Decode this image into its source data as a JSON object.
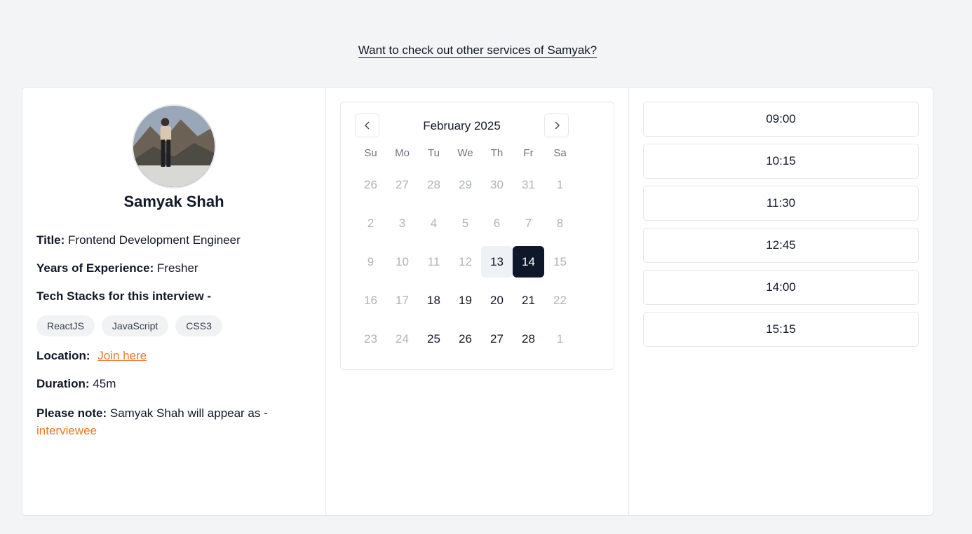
{
  "header": {
    "services_link": "Want to check out other services of Samyak?"
  },
  "profile": {
    "name": "Samyak Shah",
    "title_label": "Title:",
    "title_value": "Frontend Development Engineer",
    "experience_label": "Years of Experience:",
    "experience_value": "Fresher",
    "tech_label": "Tech Stacks for this interview -",
    "tech_stacks": [
      "ReactJS",
      "JavaScript",
      "CSS3"
    ],
    "location_label": "Location:",
    "location_link": "Join here",
    "duration_label": "Duration:",
    "duration_value": "45m",
    "note_label": "Please note:",
    "note_text": "Samyak Shah will appear as -",
    "note_role": "interviewee"
  },
  "calendar": {
    "month_label": "February 2025",
    "weekdays": [
      "Su",
      "Mo",
      "Tu",
      "We",
      "Th",
      "Fr",
      "Sa"
    ],
    "weeks": [
      [
        {
          "d": "26",
          "m": true
        },
        {
          "d": "27",
          "m": true
        },
        {
          "d": "28",
          "m": true
        },
        {
          "d": "29",
          "m": true
        },
        {
          "d": "30",
          "m": true
        },
        {
          "d": "31",
          "m": true
        },
        {
          "d": "1",
          "m": true
        }
      ],
      [
        {
          "d": "2",
          "m": true
        },
        {
          "d": "3",
          "m": true
        },
        {
          "d": "4",
          "m": true
        },
        {
          "d": "5",
          "m": true
        },
        {
          "d": "6",
          "m": true
        },
        {
          "d": "7",
          "m": true
        },
        {
          "d": "8",
          "m": true
        }
      ],
      [
        {
          "d": "9",
          "m": true
        },
        {
          "d": "10",
          "m": true
        },
        {
          "d": "11",
          "m": true
        },
        {
          "d": "12",
          "m": true
        },
        {
          "d": "13",
          "m": false,
          "today": true
        },
        {
          "d": "14",
          "m": false,
          "selected": true
        },
        {
          "d": "15",
          "m": true
        }
      ],
      [
        {
          "d": "16",
          "m": true
        },
        {
          "d": "17",
          "m": true
        },
        {
          "d": "18",
          "m": false
        },
        {
          "d": "19",
          "m": false
        },
        {
          "d": "20",
          "m": false
        },
        {
          "d": "21",
          "m": false
        },
        {
          "d": "22",
          "m": true
        }
      ],
      [
        {
          "d": "23",
          "m": true
        },
        {
          "d": "24",
          "m": true
        },
        {
          "d": "25",
          "m": false
        },
        {
          "d": "26",
          "m": false
        },
        {
          "d": "27",
          "m": false
        },
        {
          "d": "28",
          "m": false
        },
        {
          "d": "1",
          "m": true
        }
      ]
    ]
  },
  "slots": [
    "09:00",
    "10:15",
    "11:30",
    "12:45",
    "14:00",
    "15:15"
  ],
  "colors": {
    "accent": "#ea7a2e",
    "selected_day": "#0f172a",
    "background": "#f3f4f6"
  }
}
